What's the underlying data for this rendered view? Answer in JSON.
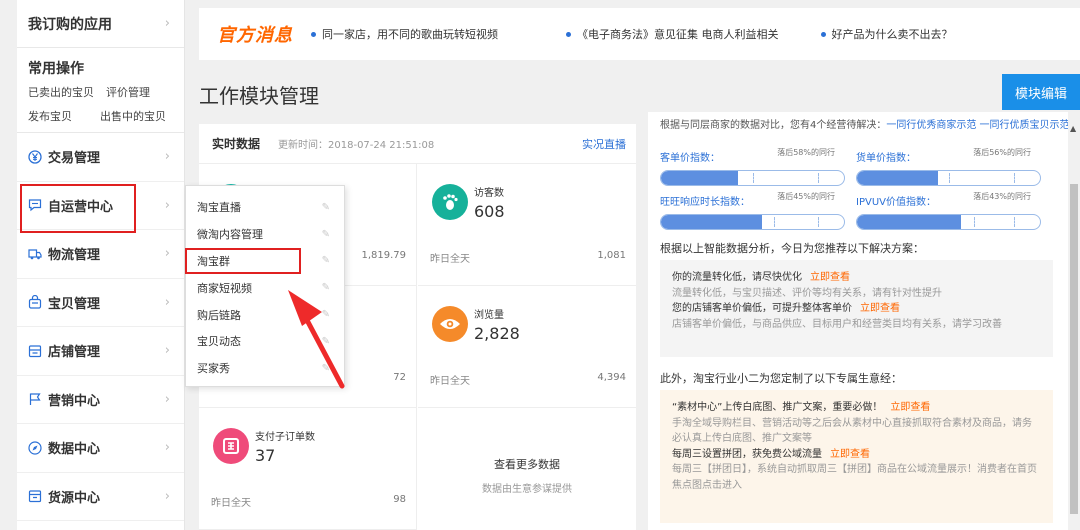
{
  "sidebar": {
    "my_apps": "我订购的应用",
    "common_title": "常用操作",
    "common_links": [
      [
        "已卖出的宝贝",
        "评价管理"
      ],
      [
        "发布宝贝",
        "出售中的宝贝"
      ]
    ],
    "items": [
      {
        "label": "交易管理",
        "icon": "yen-icon"
      },
      {
        "label": "自运营中心",
        "icon": "chat-icon"
      },
      {
        "label": "物流管理",
        "icon": "truck-icon"
      },
      {
        "label": "宝贝管理",
        "icon": "bag-icon"
      },
      {
        "label": "店铺管理",
        "icon": "store-icon"
      },
      {
        "label": "营销中心",
        "icon": "flag-icon"
      },
      {
        "label": "数据中心",
        "icon": "compass-icon"
      },
      {
        "label": "货源中心",
        "icon": "box-icon"
      }
    ]
  },
  "flyout": [
    "淘宝直播",
    "微淘内容管理",
    "淘宝群",
    "商家短视频",
    "购后链路",
    "宝贝动态",
    "买家秀"
  ],
  "news": {
    "logo": "官方消息",
    "items": [
      "同一家店，用不同的歌曲玩转短视频",
      "《电子商务法》意见征集 电商人利益相关",
      "好产品为什么卖不出去？"
    ]
  },
  "page_title": "工作模块管理",
  "edit_button": "模块编辑",
  "realtime": {
    "title": "实时数据",
    "updated": "更新时间：2018-07-24 21:51:08",
    "live_link": "实况直播",
    "cells": [
      {
        "label": "",
        "value": "",
        "footer": "",
        "footer_value": "1,819.79"
      },
      {
        "label": "访客数",
        "value": "608",
        "footer": "昨日全天",
        "footer_value": "1,081"
      },
      {
        "label": "",
        "value": "",
        "footer": "",
        "footer_value": "72"
      },
      {
        "label": "浏览量",
        "value": "2,828",
        "footer": "昨日全天",
        "footer_value": "4,394"
      },
      {
        "label": "支付子订单数",
        "value": "37",
        "footer": "昨日全天",
        "footer_value": "98"
      }
    ],
    "more_title": "查看更多数据",
    "more_sub": "数据由生意参谋提供"
  },
  "right": {
    "cut_text": "根据与同层商家的数据对比，您有4个经营待解决：",
    "cut_links": "一同行优秀商家示范  一同行优质宝贝示范",
    "metrics": [
      {
        "label": "客单价指数：",
        "behind": "落后58%的同行",
        "fill": 0.42
      },
      {
        "label": "货单价指数：",
        "behind": "落后56%的同行",
        "fill": 0.44
      },
      {
        "label": "旺旺响应时长指数：",
        "behind": "落后45%的同行",
        "fill": 0.55
      },
      {
        "label": "IPVUV价值指数：",
        "behind": "落后43%的同行",
        "fill": 0.57
      }
    ],
    "solution_intro": "根据以上智能数据分析，今日为您推荐以下解决方案：",
    "box1": {
      "l1": "你的流量转化低，请尽快优化",
      "l1_link": "立即查看",
      "l2": "流量转化低，与宝贝描述、评价等均有关系，请有针对性提升",
      "l3": "您的店铺客单价偏低，可提升整体客单价",
      "l3_link": "立即查看",
      "l4": "店铺客单价偏低，与商品供应、目标用户和经营类目均有关系，请学习改善"
    },
    "custom_intro": "此外，淘宝行业小二为您定制了以下专属生意经：",
    "box2": {
      "l1": "“素材中心”上传白底图、推广文案，重要必做！",
      "l1_link": "立即查看",
      "l2": "手淘全域导购栏目、营销活动等之后会从素材中心直接抓取符合素材及商品，请务必认真上传白底图、推广文案等",
      "l3": "每周三设置拼团，获免费公域流量",
      "l3_link": "立即查看",
      "l4": "每周三【拼团日】，系统自动抓取周三【拼团】商品在公域流量展示！消费者在首页焦点图点击进入"
    },
    "colors": {
      "blue": "#2b70d6",
      "orange": "#ff6600",
      "accent": "#1a8fe8"
    }
  }
}
